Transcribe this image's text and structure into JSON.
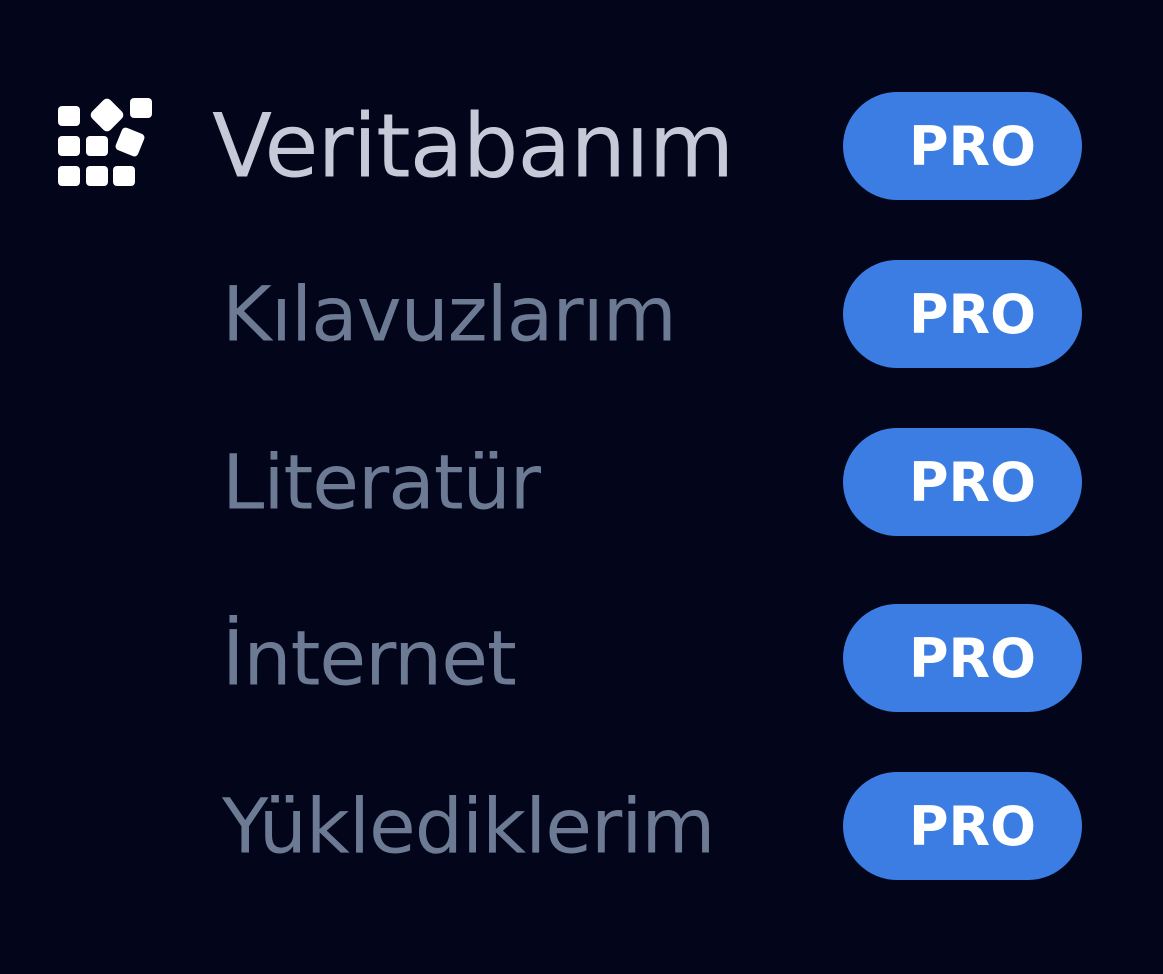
{
  "menu": {
    "primary": {
      "icon": "database-icon",
      "label": "Veritabanım",
      "badge": "PRO"
    },
    "items": [
      {
        "label": "Kılavuzlarım",
        "badge": "PRO"
      },
      {
        "label": "Literatür",
        "badge": "PRO"
      },
      {
        "label": "İnternet",
        "badge": "PRO"
      },
      {
        "label": "Yüklediklerim",
        "badge": "PRO"
      }
    ]
  },
  "colors": {
    "background": "#03051a",
    "primary_text": "#c4cad8",
    "secondary_text": "#6c7a94",
    "badge_bg": "#3b7de2",
    "badge_text": "#ffffff",
    "icon": "#ffffff"
  }
}
